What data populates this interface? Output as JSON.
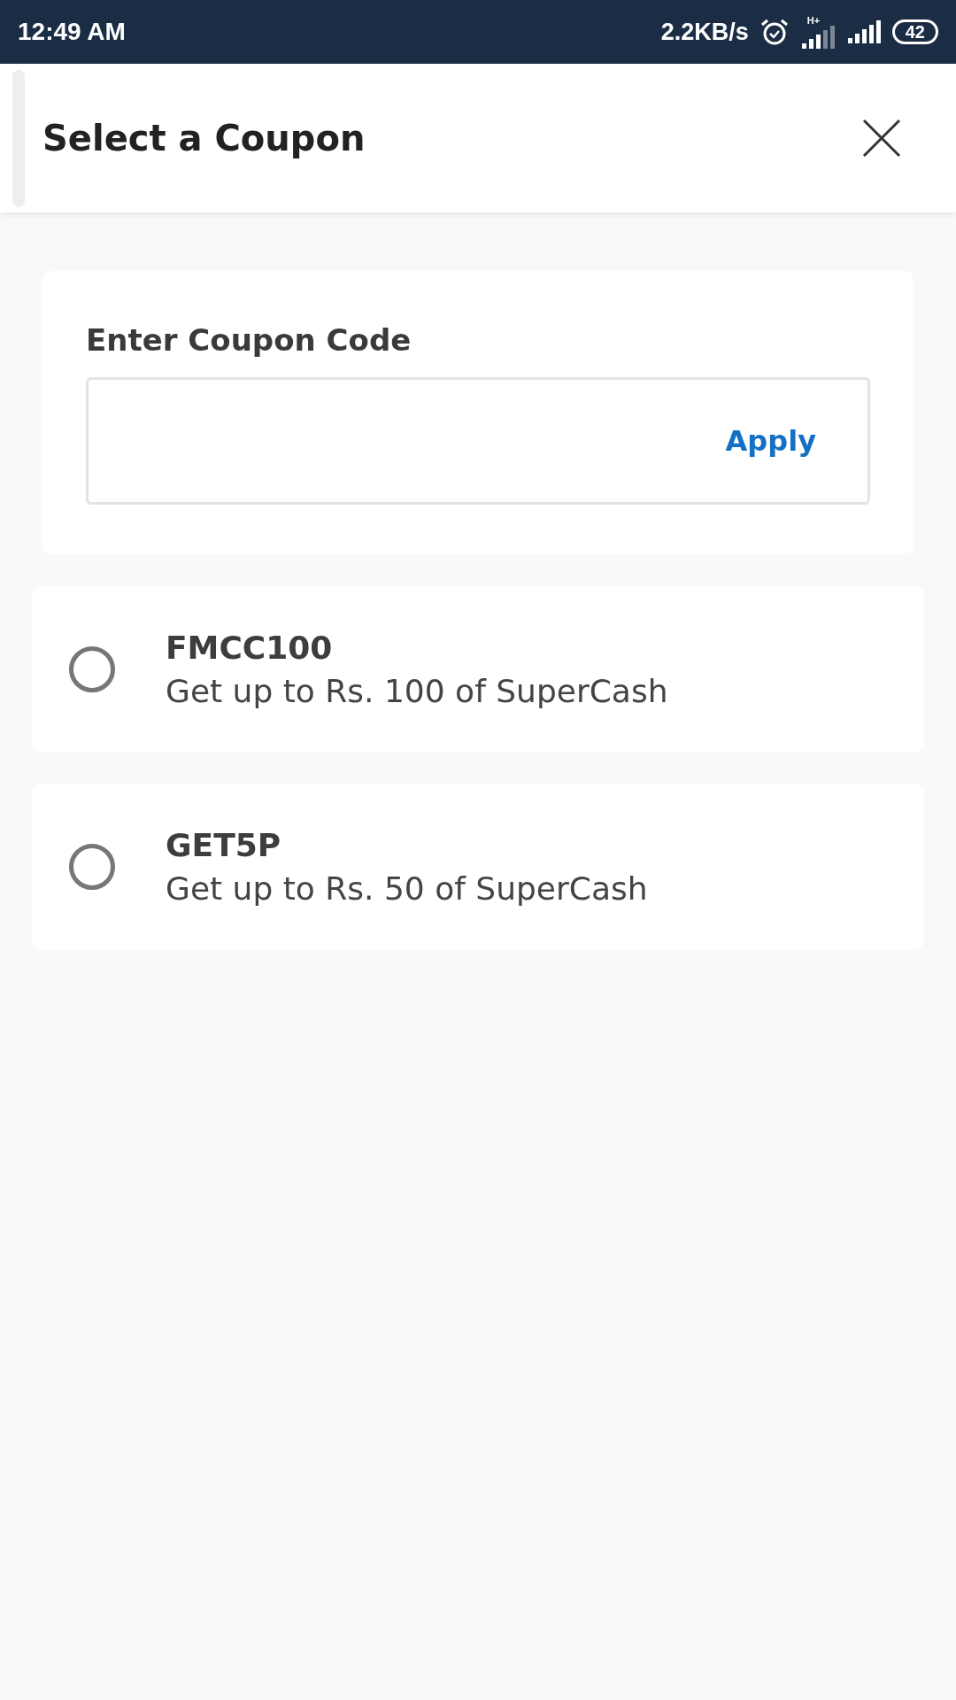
{
  "status_bar": {
    "time": "12:49 AM",
    "speed": "2.2KB/s",
    "network": "H+",
    "battery": "42"
  },
  "header": {
    "title": "Select a Coupon"
  },
  "coupon_entry": {
    "label": "Enter Coupon Code",
    "apply": "Apply"
  },
  "coupons": [
    {
      "code": "FMCC100",
      "description": "Get up to Rs. 100 of SuperCash",
      "selected": false
    },
    {
      "code": "GET5P",
      "description": "Get up to Rs. 50 of SuperCash",
      "selected": false
    }
  ]
}
